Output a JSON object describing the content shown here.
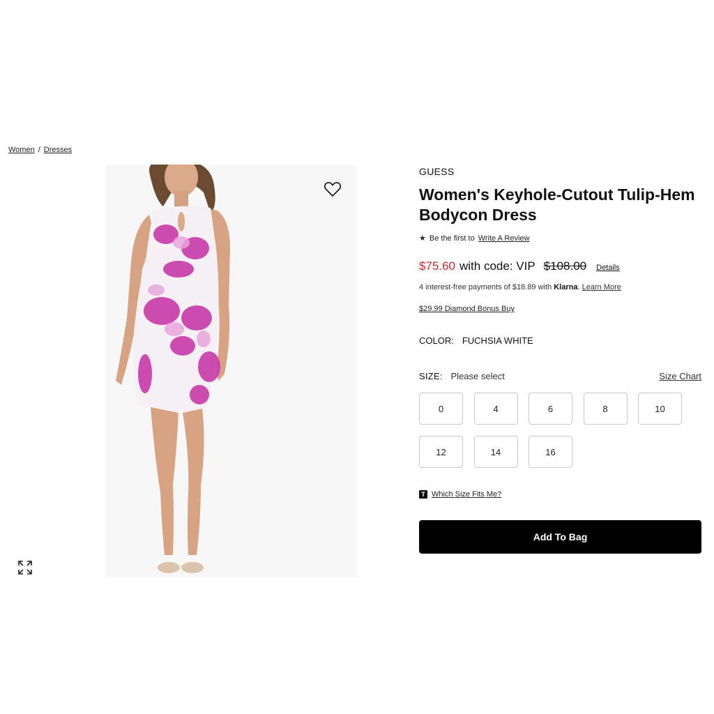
{
  "breadcrumb": {
    "items": [
      "Women",
      "Dresses"
    ],
    "separator": "/"
  },
  "product": {
    "brand": "GUESS",
    "title": "Women's Keyhole-Cutout Tulip-Hem Bodycon Dress",
    "review": {
      "prefix": "Be the first to",
      "link": "Write A Review"
    },
    "price": {
      "sale": "$75.60",
      "code_text": "with code: VIP",
      "original": "$108.00",
      "details_label": "Details",
      "sale_color": "#d12b2b"
    },
    "klarna": {
      "text": "4 interest-free payments of $18.89 with",
      "brand": "Klarna",
      "link": "Learn More"
    },
    "bonus": "$29.99 Diamond Bonus Buy",
    "color": {
      "label": "COLOR:",
      "value": "FUCHSIA WHITE"
    },
    "size": {
      "label": "SIZE:",
      "hint": "Please select",
      "chart_link": "Size Chart",
      "options": [
        "0",
        "4",
        "6",
        "8",
        "10",
        "12",
        "14",
        "16"
      ]
    },
    "fit": {
      "icon_letter": "T",
      "link": "Which Size Fits Me?"
    },
    "cta": "Add To Bag"
  },
  "icons": {
    "favorite": "heart-icon",
    "expand": "expand-icon",
    "star": "star-icon"
  }
}
